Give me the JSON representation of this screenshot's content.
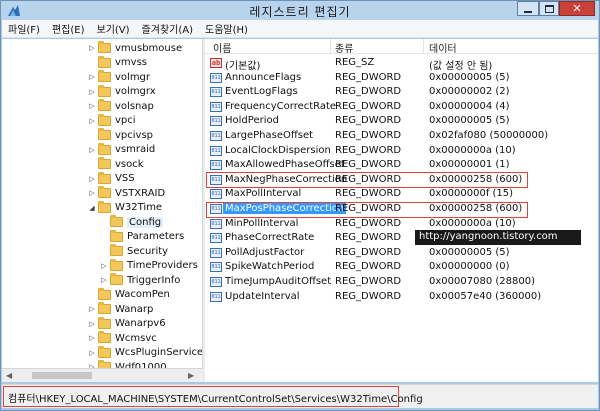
{
  "window": {
    "title": "레지스트리 편집기"
  },
  "menu": [
    "파일(F)",
    "편집(E)",
    "보기(V)",
    "즐겨찾기(A)",
    "도움말(H)"
  ],
  "tree": {
    "items": [
      {
        "label": "vmusbmouse",
        "expander": "▷"
      },
      {
        "label": "vmvss",
        "expander": ""
      },
      {
        "label": "volmgr",
        "expander": "▷"
      },
      {
        "label": "volmgrx",
        "expander": "▷"
      },
      {
        "label": "volsnap",
        "expander": "▷"
      },
      {
        "label": "vpci",
        "expander": "▷"
      },
      {
        "label": "vpcivsp",
        "expander": ""
      },
      {
        "label": "vsmraid",
        "expander": "▷"
      },
      {
        "label": "vsock",
        "expander": ""
      },
      {
        "label": "VSS",
        "expander": "▷"
      },
      {
        "label": "VSTXRAID",
        "expander": "▷"
      },
      {
        "label": "W32Time",
        "expander": "◢"
      },
      {
        "label": "Config",
        "expander": "",
        "selected": true
      },
      {
        "label": "Parameters",
        "expander": ""
      },
      {
        "label": "Security",
        "expander": ""
      },
      {
        "label": "TimeProviders",
        "expander": "▷"
      },
      {
        "label": "TriggerInfo",
        "expander": "▷"
      },
      {
        "label": "WacomPen",
        "expander": ""
      },
      {
        "label": "Wanarp",
        "expander": "▷"
      },
      {
        "label": "Wanarpv6",
        "expander": "▷"
      },
      {
        "label": "Wcmsvc",
        "expander": "▷"
      },
      {
        "label": "WcsPluginService",
        "expander": "▷"
      },
      {
        "label": "Wdf01000",
        "expander": "▷"
      },
      {
        "label": "WdiServiceHost",
        "expander": "▷"
      }
    ]
  },
  "list": {
    "headers": {
      "name": "이름",
      "type": "종류",
      "data": "데이터"
    },
    "rows": [
      {
        "icon": "ab",
        "name": "(기본값)",
        "type": "REG_SZ",
        "data": "(값 설정 안 됨)"
      },
      {
        "icon": "011",
        "name": "AnnounceFlags",
        "type": "REG_DWORD",
        "data": "0x00000005 (5)"
      },
      {
        "icon": "011",
        "name": "EventLogFlags",
        "type": "REG_DWORD",
        "data": "0x00000002 (2)"
      },
      {
        "icon": "011",
        "name": "FrequencyCorrectRate",
        "type": "REG_DWORD",
        "data": "0x00000004 (4)"
      },
      {
        "icon": "011",
        "name": "HoldPeriod",
        "type": "REG_DWORD",
        "data": "0x00000005 (5)"
      },
      {
        "icon": "011",
        "name": "LargePhaseOffset",
        "type": "REG_DWORD",
        "data": "0x02faf080 (50000000)"
      },
      {
        "icon": "011",
        "name": "LocalClockDispersion",
        "type": "REG_DWORD",
        "data": "0x0000000a (10)"
      },
      {
        "icon": "011",
        "name": "MaxAllowedPhaseOffset",
        "type": "REG_DWORD",
        "data": "0x00000001 (1)"
      },
      {
        "icon": "011",
        "name": "MaxNegPhaseCorrection",
        "type": "REG_DWORD",
        "data": "0x00000258 (600)"
      },
      {
        "icon": "011",
        "name": "MaxPollInterval",
        "type": "REG_DWORD",
        "data": "0x0000000f (15)"
      },
      {
        "icon": "011",
        "name": "MaxPosPhaseCorrection",
        "type": "REG_DWORD",
        "data": "0x00000258 (600)",
        "selected": true
      },
      {
        "icon": "011",
        "name": "MinPollInterval",
        "type": "REG_DWORD",
        "data": "0x0000000a (10)"
      },
      {
        "icon": "011",
        "name": "PhaseCorrectRate",
        "type": "REG_DWORD",
        "data": ""
      },
      {
        "icon": "011",
        "name": "PollAdjustFactor",
        "type": "REG_DWORD",
        "data": "0x00000005 (5)"
      },
      {
        "icon": "011",
        "name": "SpikeWatchPeriod",
        "type": "REG_DWORD",
        "data": "0x00000000 (0)"
      },
      {
        "icon": "011",
        "name": "TimeJumpAuditOffset",
        "type": "REG_DWORD",
        "data": "0x00007080 (28800)"
      },
      {
        "icon": "011",
        "name": "UpdateInterval",
        "type": "REG_DWORD",
        "data": "0x00057e40 (360000)"
      }
    ]
  },
  "watermark": "http://yangnoon.tistory.com",
  "status": {
    "path": "컴퓨터\\HKEY_LOCAL_MACHINE\\SYSTEM\\CurrentControlSet\\Services\\W32Time\\Config"
  },
  "colors": {
    "selection": "#3399ff",
    "outline": "#e2403c",
    "window_frame": "#a9cbe8"
  }
}
